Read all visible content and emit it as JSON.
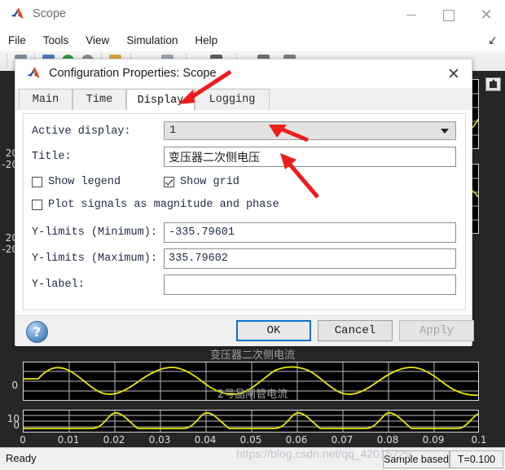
{
  "window": {
    "title": "Scope",
    "icon": "matlab-logo-icon",
    "controls": {
      "minimize": "–",
      "maximize": "□",
      "close": "✕"
    },
    "menus": [
      "File",
      "Tools",
      "View",
      "Simulation",
      "Help"
    ],
    "dock_icon": "undock-arrow-icon"
  },
  "statusbar": {
    "status": "Ready",
    "mode": "Sample based",
    "time": "T=0.100",
    "watermark": "https://blog.csdn.net/qq_42015729"
  },
  "scope": {
    "fullscreen_icon": "maximize-axes-icon",
    "panels": [
      {
        "title": "",
        "ylabels": [
          "20",
          "-20"
        ]
      },
      {
        "title": "",
        "ylabels": [
          "20",
          "-20"
        ]
      },
      {
        "title": "变压器二次侧电流",
        "ylabels": [
          "0"
        ]
      },
      {
        "title": "2号晶闸管电流",
        "ylabels": [
          "10",
          "0"
        ]
      }
    ],
    "xticks": [
      "0",
      "0.01",
      "0.02",
      "0.03",
      "0.04",
      "0.05",
      "0.06",
      "0.07",
      "0.08",
      "0.09",
      "0.1"
    ],
    "trace_color": "#e8e800",
    "background_color": "#262626",
    "axes_color": "#000000"
  },
  "dialog": {
    "icon": "matlab-logo-icon",
    "title": "Configuration Properties: Scope",
    "close_label": "✕",
    "tabs": [
      {
        "label": "Main",
        "active": false
      },
      {
        "label": "Time",
        "active": false
      },
      {
        "label": "Display",
        "active": true
      },
      {
        "label": "Logging",
        "active": false
      }
    ],
    "fields": {
      "active_display_label": "Active display:",
      "active_display_value": "1",
      "title_label": "Title:",
      "title_value": "变压器二次侧电压",
      "show_legend_label": "Show legend",
      "show_legend_checked": false,
      "show_grid_label": "Show grid",
      "show_grid_checked": true,
      "plot_magnitude_label": "Plot signals as magnitude and phase",
      "plot_magnitude_checked": false,
      "ylimit_min_label": "Y-limits (Minimum):",
      "ylimit_min_value": "-335.79601",
      "ylimit_max_label": "Y-limits (Maximum):",
      "ylimit_max_value": "335.79602",
      "ylabel_label": "Y-label:",
      "ylabel_value": ""
    },
    "buttons": {
      "help": "?",
      "ok": "OK",
      "cancel": "Cancel",
      "apply": "Apply"
    }
  },
  "annotations": {
    "arrow_color": "#ee1c1c",
    "arrows": [
      "points-to-display-tab",
      "points-to-active-display-dropdown",
      "points-to-title-field"
    ]
  }
}
